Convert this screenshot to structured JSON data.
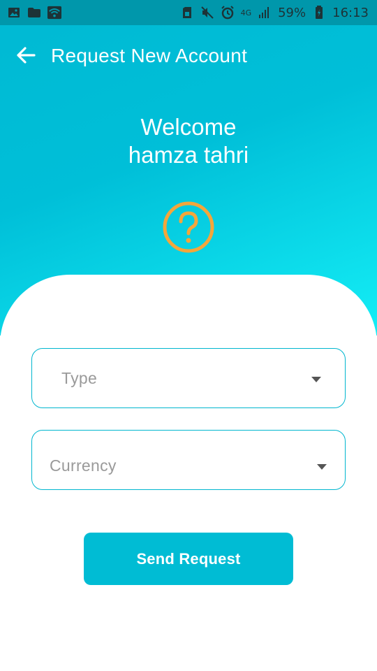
{
  "status_bar": {
    "battery": "59%",
    "time": "16:13",
    "network": "4G",
    "left_icons": [
      "image-icon",
      "folder-icon",
      "wifi-icon"
    ],
    "right_icons": [
      "sim-icon",
      "mute-icon",
      "alarm-icon",
      "signal-icon",
      "battery-icon"
    ]
  },
  "app_bar": {
    "title": "Request New Account",
    "back_icon": "arrow-left-icon"
  },
  "welcome": {
    "line1": "Welcome",
    "line2": "hamza tahri"
  },
  "help_icon": "question-circle-icon",
  "form": {
    "type_label": "Type",
    "currency_label": "Currency"
  },
  "submit_label": "Send Request",
  "colors": {
    "primary": "#00bcd4",
    "accent": "#f4a63b",
    "status_bar": "#0097ab",
    "placeholder": "#9a9a9a"
  }
}
